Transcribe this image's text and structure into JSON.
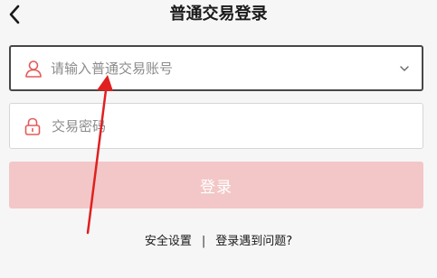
{
  "header": {
    "title": "普通交易登录",
    "back_icon": "chevron-left-icon"
  },
  "account_field": {
    "placeholder": "请输入普通交易账号",
    "value": "",
    "icon": "user-icon",
    "dropdown_icon": "chevron-down-icon"
  },
  "password_field": {
    "placeholder": "交易密码",
    "value": "",
    "icon": "lock-icon"
  },
  "login_button": {
    "label": "登录",
    "color": "#f3c7c7"
  },
  "links": {
    "security_settings": "安全设置",
    "separator": "|",
    "login_problem": "登录遇到问题?"
  },
  "colors": {
    "accent": "#e04848",
    "annotation_arrow": "#e02020"
  }
}
